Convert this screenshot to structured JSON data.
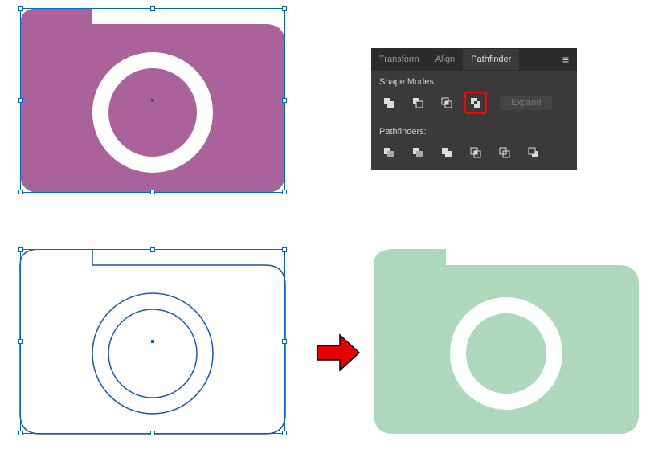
{
  "panel": {
    "tabs": {
      "transform": "Transform",
      "align": "Align",
      "pathfinder": "Pathfinder"
    },
    "section_shape_modes": "Shape Modes:",
    "section_pathfinders": "Pathfinders:",
    "expand_label": "Expand"
  },
  "colors": {
    "purple": "#aa629b",
    "green": "#add8bb",
    "outline_blue": "#2156a5",
    "arrow_red": "#e40000",
    "panel_bg": "#3a3a3a",
    "highlight_red": "#ff0000"
  },
  "icons": {
    "unite": "unite-icon",
    "minus_front": "minus-front-icon",
    "intersect": "intersect-icon",
    "exclude": "exclude-icon",
    "divide": "divide-icon",
    "trim": "trim-icon",
    "merge": "merge-icon",
    "crop": "crop-icon",
    "outline": "outline-icon",
    "minus_back": "minus-back-icon"
  }
}
